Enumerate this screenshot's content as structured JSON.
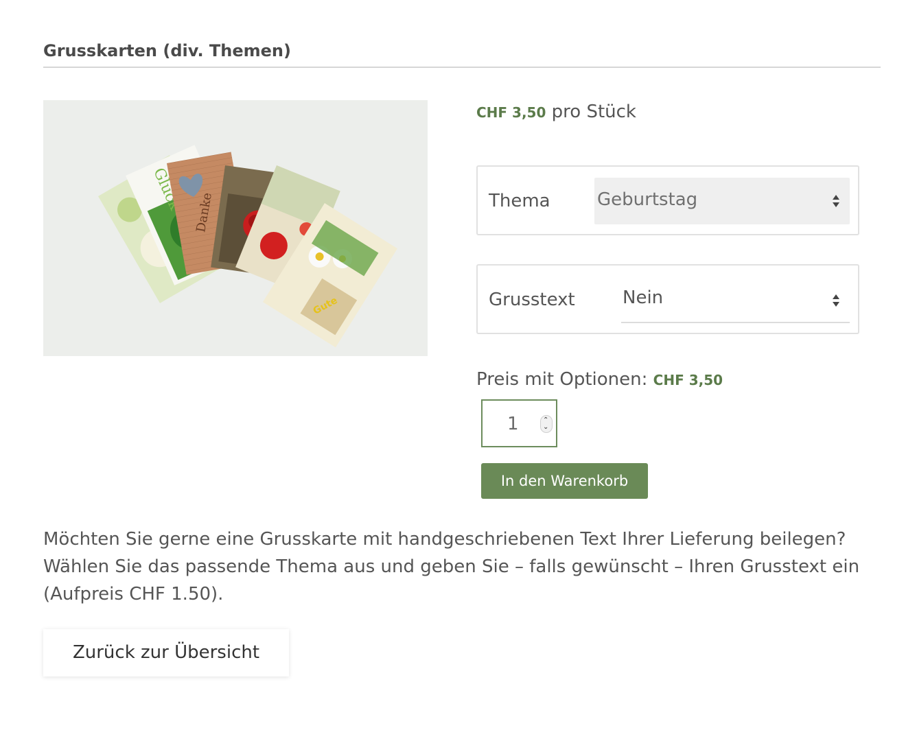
{
  "product": {
    "title": "Grusskarten (div. Themen)",
    "price": "CHF 3,50",
    "price_unit": "pro Stück"
  },
  "options": {
    "thema": {
      "label": "Thema",
      "value": "Geburtstag"
    },
    "grusstext": {
      "label": "Grusstext",
      "value": "Nein"
    }
  },
  "options_price": {
    "label": "Preis mit Optionen:",
    "value": "CHF 3,50"
  },
  "quantity": {
    "value": "1"
  },
  "cart_button": {
    "label": "In den Warenkorb"
  },
  "description": {
    "line1": "Möchten Sie gerne eine Grusskarte mit handgeschriebenen Text Ihrer Lieferung beilegen?",
    "line2": "Wählen Sie das passende Thema aus und geben Sie – falls gewünscht – Ihren Grusstext ein",
    "line3": "(Aufpreis CHF 1.50)."
  },
  "back_button": {
    "label": "Zurück zur Übersicht"
  },
  "colors": {
    "accent": "#6a8a57",
    "price_text": "#5b7b4a",
    "text": "#555555"
  },
  "icons": [
    "select-arrows-icon",
    "quantity-spinner-icon"
  ]
}
